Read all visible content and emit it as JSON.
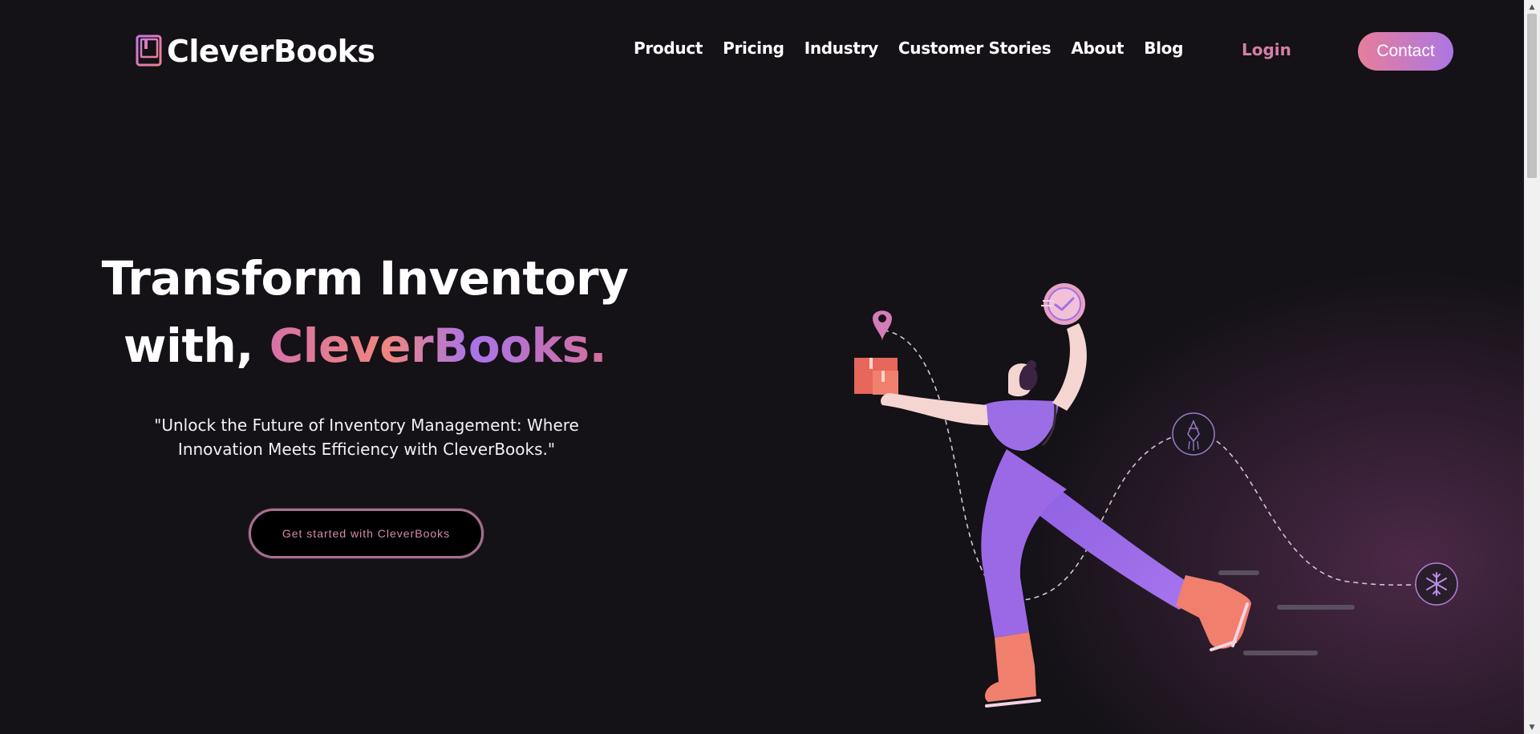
{
  "brand": {
    "name": "CleverBooks"
  },
  "nav": [
    {
      "label": "Product"
    },
    {
      "label": "Pricing"
    },
    {
      "label": "Industry"
    },
    {
      "label": "Customer Stories"
    },
    {
      "label": "About"
    },
    {
      "label": "Blog"
    }
  ],
  "header": {
    "login_label": "Login",
    "contact_label": "Contact"
  },
  "hero": {
    "title_line1": "Transform Inventory",
    "title_line2_prefix": "with, ",
    "title_line2_highlight": "CleverBooks.",
    "quote": "\"Unlock the Future of Inventory Management: Where Innovation Meets Efficiency with CleverBooks.\"",
    "cta_label": "Get started with CleverBooks"
  },
  "colors": {
    "background": "#141117",
    "accent_pink": "#e67e9b",
    "accent_purple": "#ad76e3",
    "accent_coral": "#f0857e",
    "figure_purple": "#9d6be6"
  },
  "icons": [
    "book-logo-icon",
    "location-pin-icon",
    "package-box-icon",
    "clock-check-icon",
    "lantern-icon",
    "snowflake-icon",
    "scroll-up-arrow-icon",
    "scroll-down-arrow-icon"
  ]
}
